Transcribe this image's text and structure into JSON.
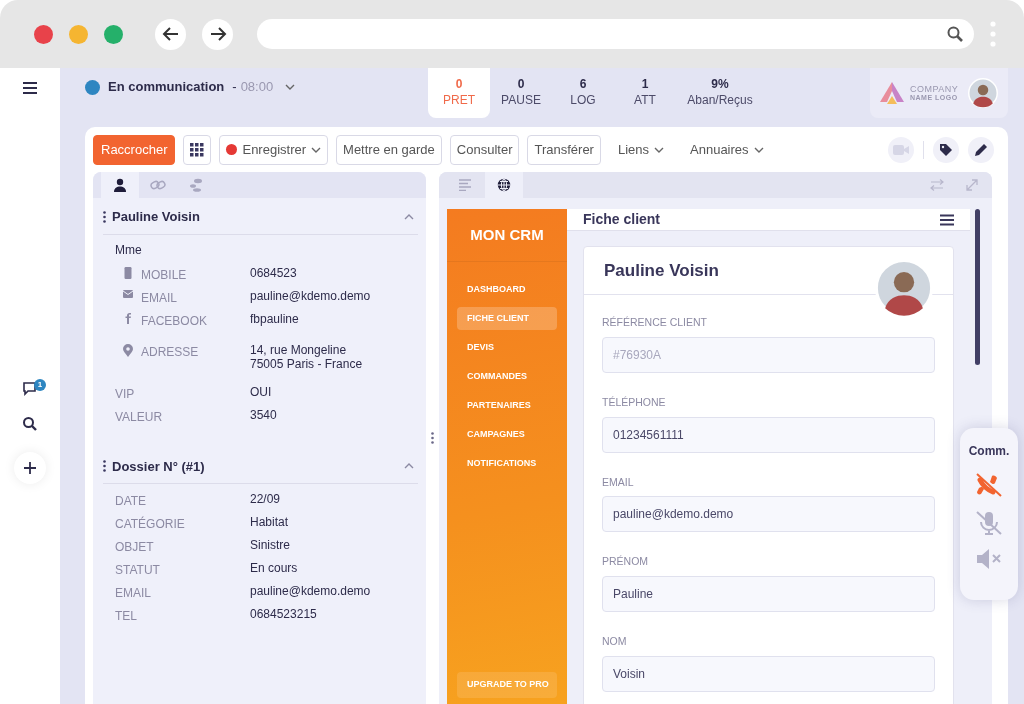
{
  "sidebar": {
    "items": [
      {
        "kind": "chat",
        "badge": "1"
      },
      {
        "kind": "search"
      },
      {
        "kind": "add"
      }
    ]
  },
  "status": {
    "label": "En communication",
    "separator": "-",
    "time": "08:00",
    "color": "#2e86c1"
  },
  "stats": [
    {
      "value": "0",
      "label": "PRET",
      "selected": true
    },
    {
      "value": "0",
      "label": "PAUSE",
      "selected": false
    },
    {
      "value": "6",
      "label": "LOG",
      "selected": false
    },
    {
      "value": "1",
      "label": "ATT",
      "selected": false
    },
    {
      "value": "9%",
      "label": "Aban/Reçus",
      "selected": false
    }
  ],
  "company": {
    "line1": "COMPANY",
    "line2": "NAME LOGO"
  },
  "toolbar": {
    "items": [
      {
        "kind": "primary",
        "label": "Raccrocher"
      },
      {
        "kind": "grid"
      },
      {
        "kind": "record",
        "label": "Enregistrer",
        "color": "#e53935"
      },
      {
        "kind": "outline",
        "label": "Mettre en garde"
      },
      {
        "kind": "outline",
        "label": "Consulter"
      },
      {
        "kind": "outline",
        "label": "Transférer"
      },
      {
        "kind": "dropdown",
        "label": "Liens"
      },
      {
        "kind": "dropdown",
        "label": "Annuaires"
      }
    ],
    "actions": [
      {
        "kind": "video",
        "disabled": true
      },
      {
        "kind": "tag",
        "disabled": false
      },
      {
        "kind": "pencil",
        "disabled": false
      }
    ]
  },
  "left_panel": {
    "tabs": [
      {
        "kind": "person",
        "selected": true
      },
      {
        "kind": "link",
        "selected": false
      },
      {
        "kind": "steps",
        "selected": false
      }
    ],
    "sections": [
      {
        "title": "Pauline Voisin",
        "expanded": true,
        "rows": [
          {
            "value": "Mme"
          },
          {
            "kind": "mobile",
            "label": "MOBILE",
            "value": "0684523"
          },
          {
            "kind": "envelope",
            "label": "EMAIL",
            "value": "pauline@kdemo.demo"
          },
          {
            "kind": "social",
            "label": "FACEBOOK",
            "value": "fbpauline"
          },
          {
            "kind": "pin",
            "label": "ADRESSE",
            "lines": [
              "14, rue Mongeline",
              "75005 Paris - France"
            ]
          },
          {
            "label": "VIP",
            "value": "OUI"
          },
          {
            "label": "VALEUR",
            "value": "3540"
          }
        ]
      },
      {
        "title": "Dossier N° (#1)",
        "expanded": true,
        "rows": [
          {
            "label": "DATE",
            "value": "22/09"
          },
          {
            "label": "CATÉGORIE",
            "value": "Habitat"
          },
          {
            "label": "OBJET",
            "value": "Sinistre"
          },
          {
            "label": "STATUT",
            "value": "En cours"
          },
          {
            "label": "EMAIL",
            "value": "pauline@kdemo.demo"
          },
          {
            "label": "TEL",
            "value": "0684523215"
          }
        ]
      }
    ]
  },
  "right_panel": {
    "tabs": [
      {
        "kind": "lines",
        "selected": false
      },
      {
        "kind": "globe",
        "selected": true
      }
    ]
  },
  "crm": {
    "brand": "MON CRM",
    "nav": [
      {
        "label": "DASHBOARD",
        "selected": false
      },
      {
        "label": "FICHE CLIENT",
        "selected": true
      },
      {
        "label": "DEVIS",
        "selected": false
      },
      {
        "label": "COMMANDES",
        "selected": false
      },
      {
        "label": "PARTENAIRES",
        "selected": false
      },
      {
        "label": "CAMPAGNES",
        "selected": false
      },
      {
        "label": "NOTIFICATIONS",
        "selected": false
      }
    ],
    "upgrade": "UPGRADE TO PRO",
    "header": "Fiche client",
    "card": {
      "name": "Pauline Voisin",
      "fields": [
        {
          "label": "RÉFÉRENCE CLIENT",
          "placeholder": "#76930A"
        },
        {
          "label": "TÉLÉPHONE",
          "value": "01234561111"
        },
        {
          "label": "EMAIL",
          "value": "pauline@kdemo.demo"
        },
        {
          "label": "PRÉNOM",
          "value": "Pauline"
        },
        {
          "label": "NOM",
          "value": "Voisin"
        }
      ]
    }
  },
  "comm": {
    "title": "Comm.",
    "controls": [
      {
        "kind": "phone",
        "active": true
      },
      {
        "kind": "mic",
        "active": false
      },
      {
        "kind": "speaker",
        "active": false
      }
    ]
  }
}
